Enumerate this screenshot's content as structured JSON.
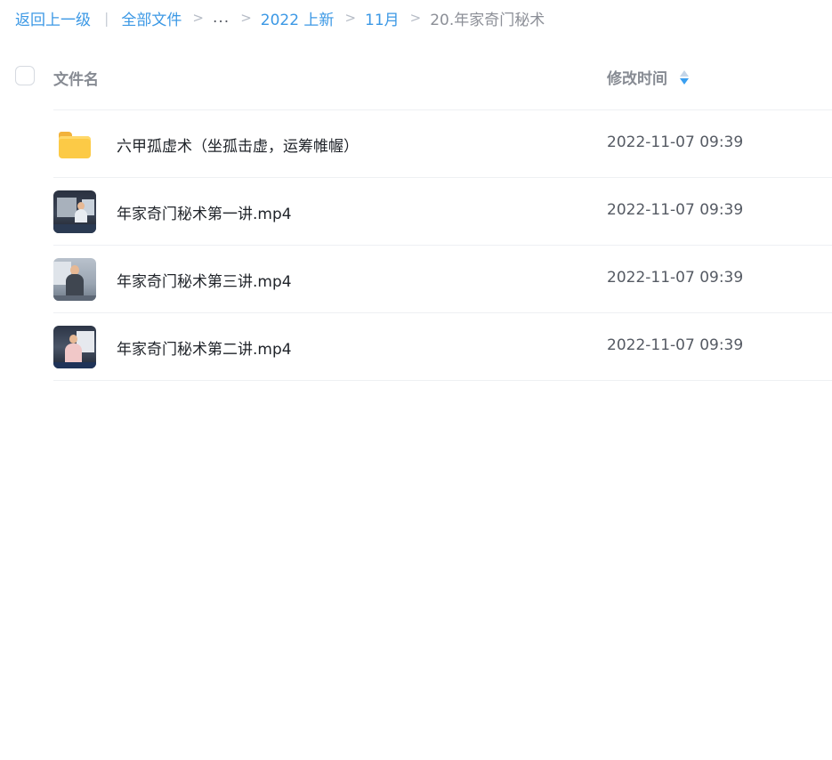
{
  "breadcrumb": {
    "back": "返回上一级",
    "divider": "|",
    "all_files": "全部文件",
    "sep": ">",
    "ellipsis": "...",
    "level_2022": "2022 上新",
    "level_month": "11月",
    "current": "20.年家奇门秘术"
  },
  "header": {
    "name_label": "文件名",
    "time_label": "修改时间"
  },
  "colors": {
    "link": "#3b98e5",
    "folder": "#fcca46",
    "sort_active": "#3a9ff0"
  },
  "files": [
    {
      "icon": "folder-icon",
      "name": "六甲孤虚术（坐孤击虚，运筹帷幄）",
      "time": "2022-11-07 09:39"
    },
    {
      "icon": "video-thumbnail",
      "name": "年家奇门秘术第一讲.mp4",
      "time": "2022-11-07 09:39"
    },
    {
      "icon": "video-thumbnail",
      "name": "年家奇门秘术第三讲.mp4",
      "time": "2022-11-07 09:39"
    },
    {
      "icon": "video-thumbnail",
      "name": "年家奇门秘术第二讲.mp4",
      "time": "2022-11-07 09:39"
    }
  ]
}
